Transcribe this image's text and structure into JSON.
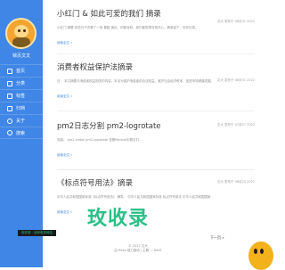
{
  "sidebar": {
    "site_name": "锦页文文",
    "items": [
      {
        "label": "首页",
        "icon": "home-icon"
      },
      {
        "label": "分类",
        "icon": "folder-icon"
      },
      {
        "label": "标签",
        "icon": "tag-icon"
      },
      {
        "label": "归档",
        "icon": "archive-icon"
      },
      {
        "label": "关于",
        "icon": "user-icon"
      },
      {
        "label": "搜索",
        "icon": "search-icon"
      }
    ]
  },
  "posts": [
    {
      "title": "小红门 & 如此可爱的我们 摘录",
      "date": "文大 发布于 08月31 2022",
      "excerpt": "小红门 摘要 前些日子去看了一场 喜剧 演出，印象深刻，我们都笑得非常开心。摘录如下，仅作记录。",
      "read_more": "阅读全文 »"
    },
    {
      "title": "消费者权益保护法摘录",
      "date": "文大 发布于 08月31 2022",
      "excerpt": "日： 本文摘要与消费者权益相关的内容。本法为保护消费者的合法权益，维护社会经济秩序，促进市场健康发展。",
      "read_more": "阅读全文 »"
    },
    {
      "title": "pm2日志分割 pm2-logrotate",
      "date": "文大 发布于 07月07 2022",
      "excerpt": "安装： pm2 install pm2-logrotate 查看Module中看见们...",
      "read_more": "阅读全文 »"
    },
    {
      "title": "《标点符号用法》摘录",
      "date": "文大 发布于 06月20 2022",
      "excerpt": "中华人民共和国国家标准《标点符号用法》 摘录。 中华人民共和国国家标准 标点符号用法 中华人民共和国国家",
      "read_more": "阅读全文 »"
    }
  ],
  "pagination": {
    "next": "下一页 »"
  },
  "footer": {
    "line1": "© 2022 文大",
    "line2": "由 Hexo 强力驱动 | 主题 — NexT"
  },
  "watermark": {
    "text": "玫收录",
    "sub": "玫收录 · 全网收录网站"
  },
  "colors": {
    "accent": "#3f86e6",
    "watermark": "#2bbf86",
    "mascot": "#f3b21b"
  }
}
